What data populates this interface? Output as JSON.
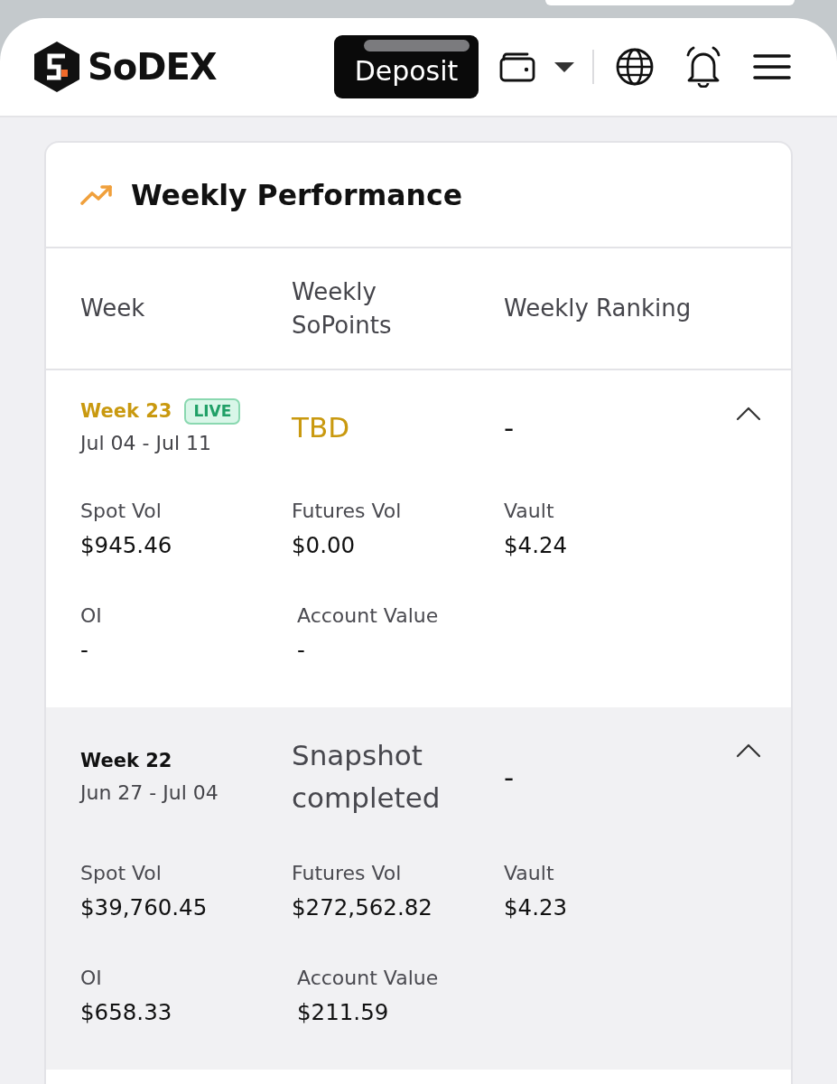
{
  "header": {
    "logo": "SoDEX",
    "deposit_button": "Deposit"
  },
  "card": {
    "title": "Weekly Performance",
    "columns": [
      "Week",
      "Weekly SoPoints",
      "Weekly Ranking"
    ],
    "rows": [
      {
        "kind": "live",
        "week": "Week 23",
        "badge": "LIVE",
        "dates": "Jul 04 - Jul 11",
        "sopoints": "TBD",
        "ranking": "-",
        "expanded": true,
        "stats": [
          {
            "label": "Spot Vol",
            "value": "$945.46"
          },
          {
            "label": "Futures Vol",
            "value": "$0.00"
          },
          {
            "label": "Vault",
            "value": "$4.24"
          },
          {
            "label": "OI",
            "value": "-"
          },
          {
            "label": "Account Value",
            "value": "-"
          }
        ]
      },
      {
        "kind": "completed",
        "week": "Week 22",
        "dates": "Jun 27 - Jul 04",
        "sopoints": "Snapshot completed",
        "ranking": "-",
        "expanded": true,
        "stats": [
          {
            "label": "Spot Vol",
            "value": "$39,760.45"
          },
          {
            "label": "Futures Vol",
            "value": "$272,562.82"
          },
          {
            "label": "Vault",
            "value": "$4.23"
          },
          {
            "label": "OI",
            "value": "$658.33"
          },
          {
            "label": "Account Value",
            "value": "$211.59"
          }
        ]
      }
    ]
  }
}
